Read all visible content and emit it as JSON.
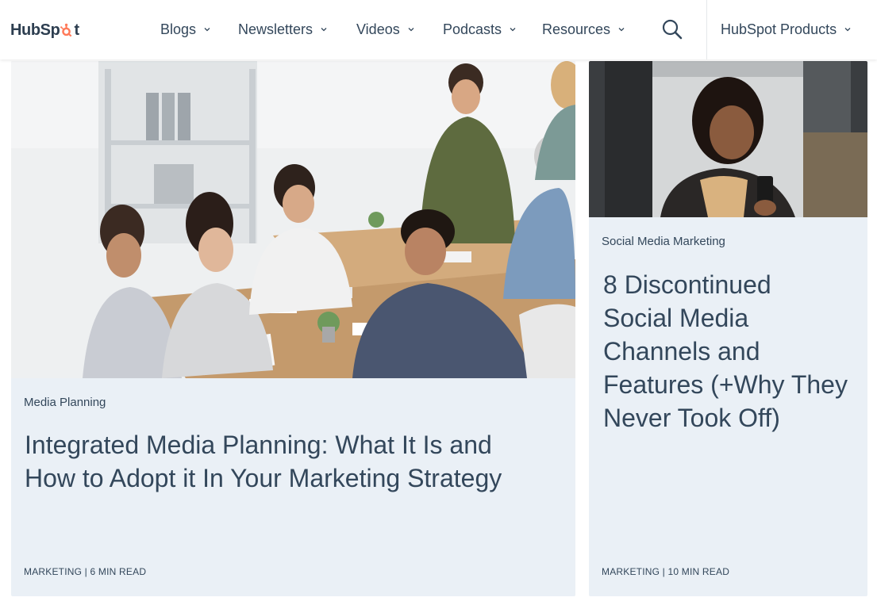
{
  "brand": {
    "name_part1": "HubSp",
    "name_part2": "t",
    "accent_color": "#ff7a59",
    "ink_color": "#2d3e50"
  },
  "nav": {
    "items": [
      {
        "label": "Blogs",
        "icon": "chevron-down-icon"
      },
      {
        "label": "Newsletters",
        "icon": "chevron-down-icon"
      },
      {
        "label": "Videos",
        "icon": "chevron-down-icon"
      },
      {
        "label": "Podcasts",
        "icon": "chevron-down-icon"
      },
      {
        "label": "Resources",
        "icon": "chevron-down-icon"
      }
    ],
    "search_icon": "search-icon",
    "products_label": "HubSpot Products"
  },
  "cards": [
    {
      "tag": "Media Planning",
      "title_line1": "Integrated Media Planning: What It Is and",
      "title_line2": "How to Adopt it In Your Marketing Strategy",
      "meta": "MARKETING | 6 MIN READ",
      "image": "team-meeting-photo"
    },
    {
      "tag": "Social Media Marketing",
      "title_line1": "8 Discontinued",
      "title_line2": "Social Media",
      "title_line3": "Channels and",
      "title_line4": "Features (+Why They",
      "title_line5": "Never Took Off)",
      "meta": "MARKETING | 10 MIN READ",
      "image": "woman-with-phone-photo"
    }
  ],
  "colors": {
    "card_bg": "#eaf0f6",
    "text": "#33475b"
  }
}
